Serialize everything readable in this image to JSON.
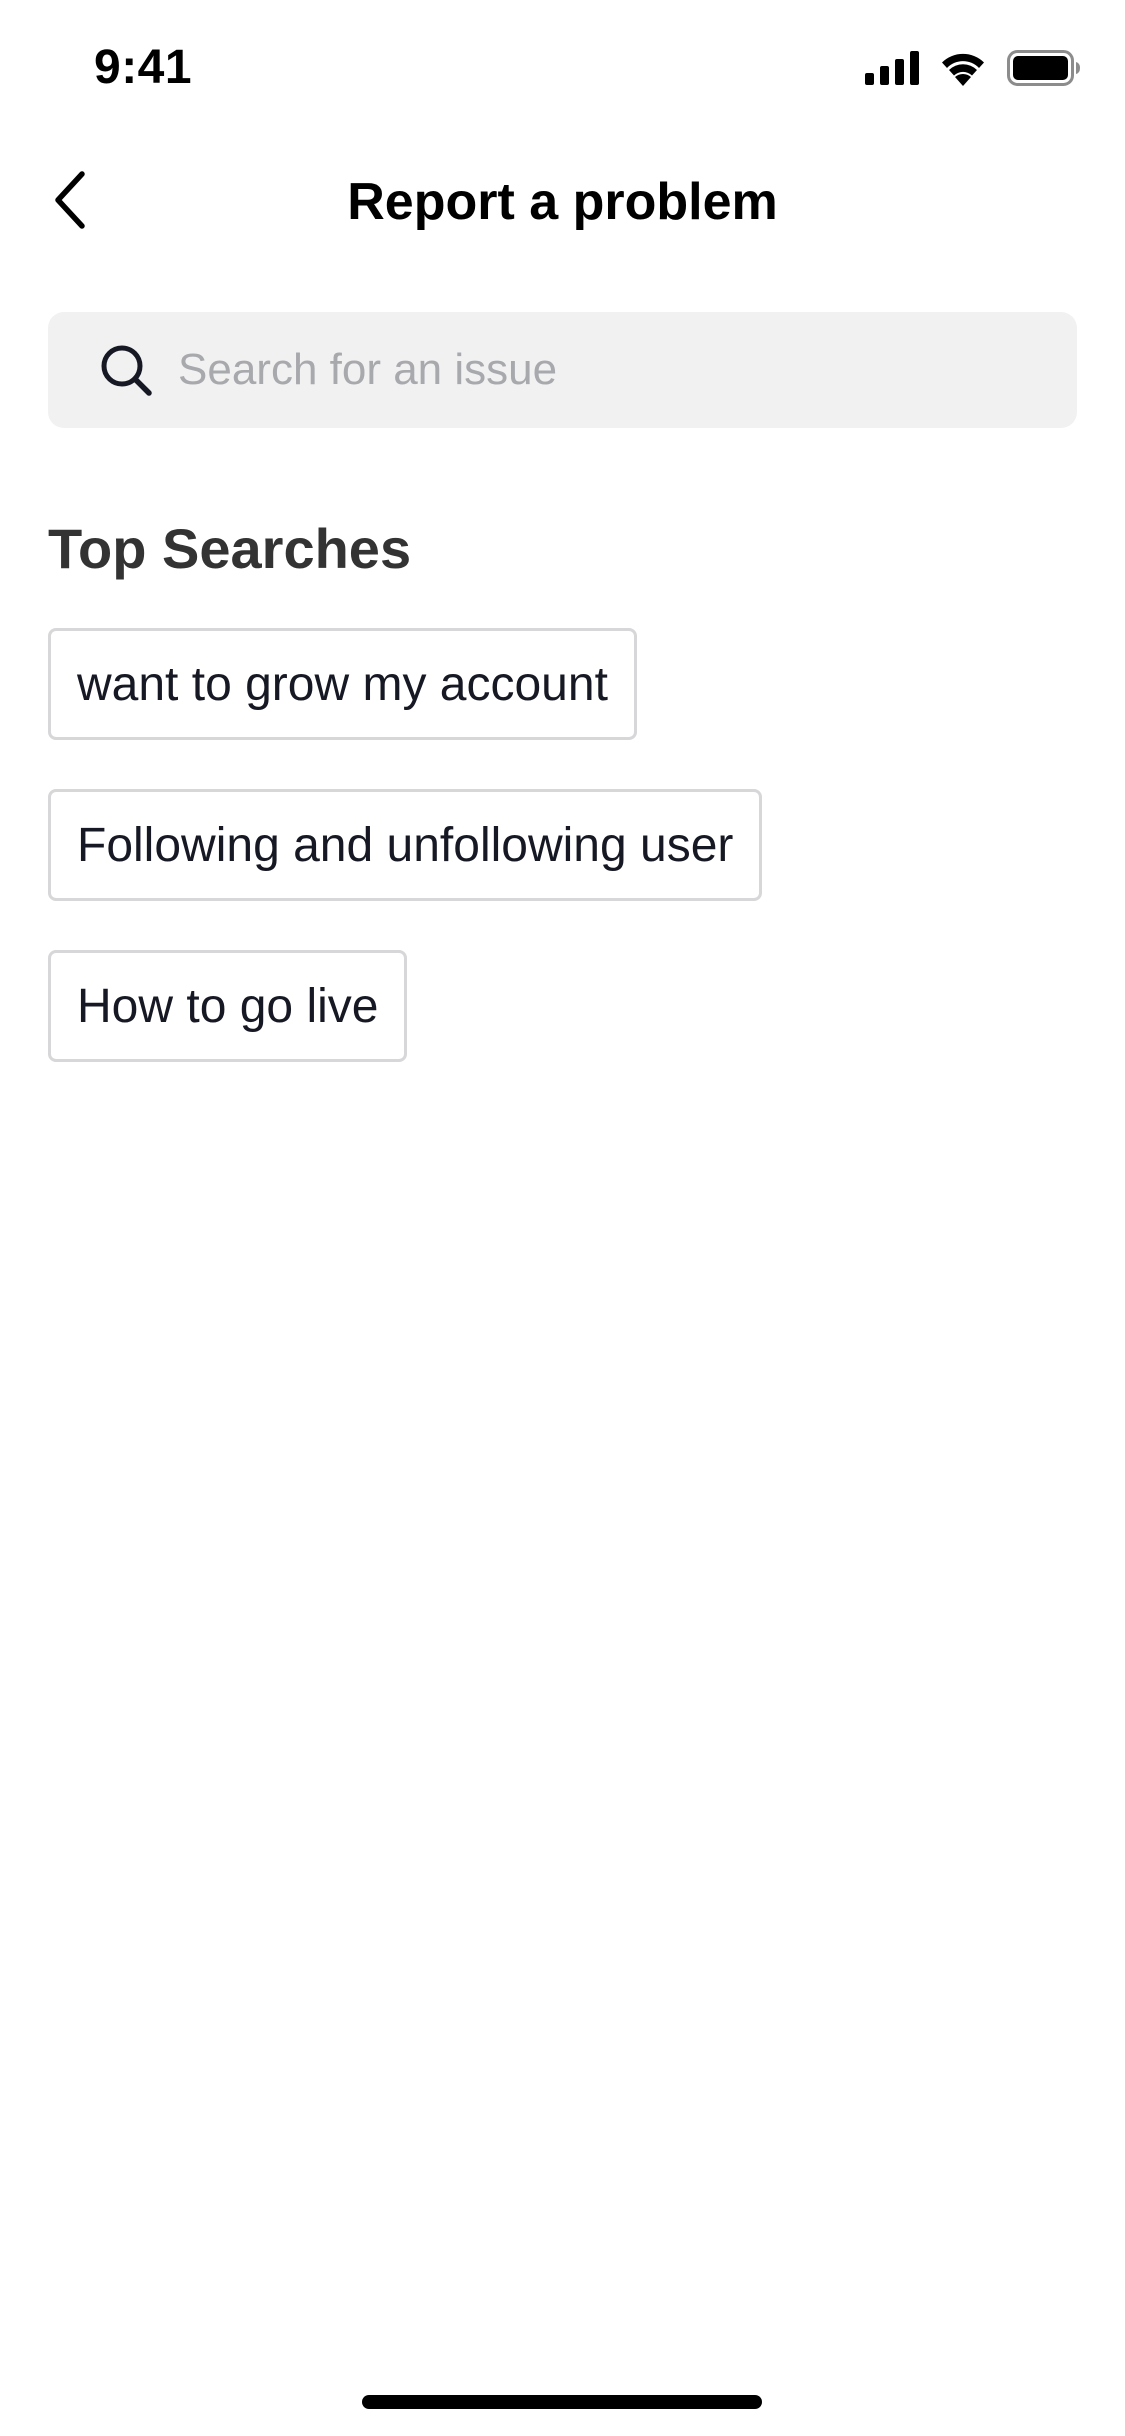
{
  "status_bar": {
    "time": "9:41",
    "icons": [
      "signal-icon",
      "wifi-icon",
      "battery-icon"
    ]
  },
  "nav": {
    "back_icon": "chevron-left-icon",
    "title": "Report a problem"
  },
  "search": {
    "icon": "search-icon",
    "placeholder": "Search for an issue",
    "value": ""
  },
  "top_searches": {
    "title": "Top Searches",
    "items": [
      {
        "label": "want to grow my account"
      },
      {
        "label": "Following and unfollowing user"
      },
      {
        "label": "How to go live"
      }
    ]
  },
  "colors": {
    "background": "#ffffff",
    "search_bg": "#f1f1f2",
    "placeholder": "#a8a9ad",
    "chip_border": "#d7d7d9",
    "text_primary": "#161823",
    "section_title": "#333333"
  }
}
